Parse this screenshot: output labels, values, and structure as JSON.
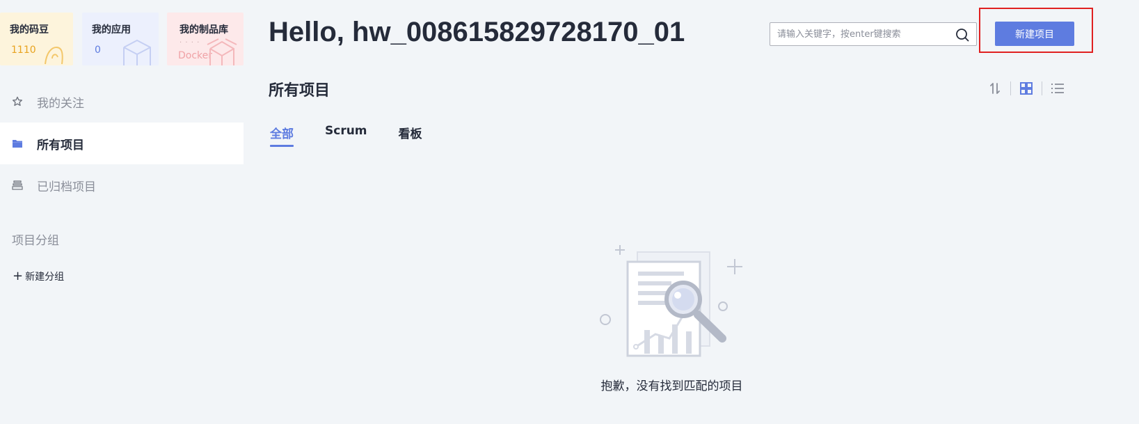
{
  "cards": [
    {
      "title": "我的码豆",
      "value": "1110"
    },
    {
      "title": "我的应用",
      "value": "0"
    },
    {
      "title": "我的制品库",
      "sub": "· · · ·",
      "value": "Docker"
    }
  ],
  "nav": {
    "items": [
      {
        "label": "我的关注",
        "icon": "star-icon"
      },
      {
        "label": "所有项目",
        "icon": "folder-icon",
        "active": true
      },
      {
        "label": "已归档项目",
        "icon": "archive-icon"
      }
    ],
    "group_title": "项目分组",
    "add_group_label": "新建分组"
  },
  "header": {
    "greeting": "Hello, hw_008615829728170_01",
    "search_placeholder": "请输入关键字，按enter键搜索",
    "new_project_label": "新建项目"
  },
  "section": {
    "title": "所有项目",
    "view_controls": [
      "sort-icon",
      "grid-view-icon",
      "list-view-icon"
    ]
  },
  "tabs": [
    {
      "label": "全部",
      "active": true
    },
    {
      "label": "Scrum"
    },
    {
      "label": "看板"
    }
  ],
  "empty_state": {
    "message": "抱歉，没有找到匹配的项目"
  },
  "colors": {
    "accent": "#5e7ce0",
    "highlight_border": "#e02020",
    "background": "#f2f5f8"
  }
}
